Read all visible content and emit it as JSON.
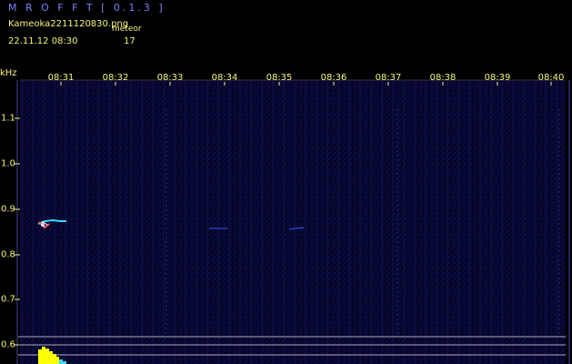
{
  "header": {
    "title": "M R O F F T  [ 0.1.3 ]",
    "filename": "Kameoka2211120830.png",
    "meteor_label": "meteor",
    "timestamp": "22.11.12 08:30",
    "meteor_count": "17"
  },
  "axes": {
    "unit": "kHz",
    "time_ticks": [
      "08:31",
      "08:32",
      "08:33",
      "08:34",
      "08:35",
      "08:36",
      "08:37",
      "08:38",
      "08:39",
      "08:40"
    ],
    "freq_ticks": [
      "1.1",
      "1.0",
      "0.9",
      "0.8",
      "0.7",
      "0.6"
    ]
  },
  "colors": {
    "text": "#f4f47a",
    "title": "#7c80ff",
    "background": "#000000",
    "spectrum": "#0a0a3c",
    "echo": "#36d7ff",
    "signal": "#ffff00"
  }
}
